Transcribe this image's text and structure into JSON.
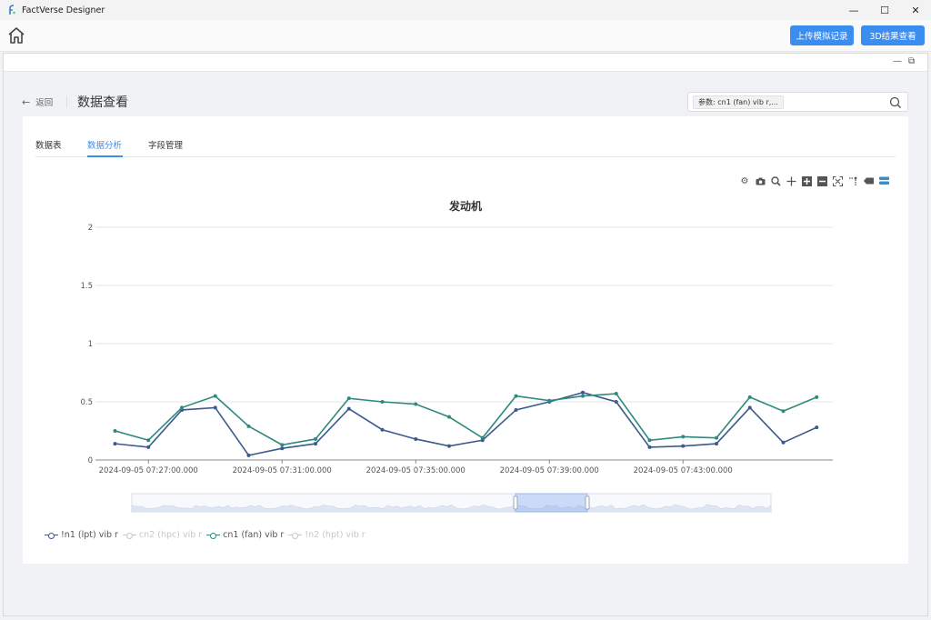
{
  "window": {
    "title": "FactVerse Designer",
    "minimize": "—",
    "maximize": "☐",
    "close": "✕"
  },
  "header": {
    "upload_label": "上传模拟记录",
    "result_label": "3D结果查看"
  },
  "inner_window": {
    "minimize": "—",
    "restore": "⧉"
  },
  "page": {
    "back_label": "返回",
    "title": "数据查看",
    "search_tag": "参数: cn1 (fan) vib r,..."
  },
  "tabs": [
    {
      "label": "数据表",
      "active": false
    },
    {
      "label": "数据分析",
      "active": true
    },
    {
      "label": "字段管理",
      "active": false
    }
  ],
  "toolbox": [
    "settings-icon",
    "camera-icon",
    "zoom-icon",
    "pan-icon",
    "zoom-in-icon",
    "zoom-out-icon",
    "autoscale-icon",
    "reset-axes-icon",
    "hover-closest-icon",
    "hover-compare-icon"
  ],
  "chart_data": {
    "type": "line",
    "title": "发动机",
    "xlabel": "",
    "ylabel": "",
    "ylim": [
      0,
      2
    ],
    "yticks": [
      "0",
      "0.5",
      "1",
      "1.5",
      "2"
    ],
    "xticks": [
      "2024-09-05 07:27:00.000",
      "2024-09-05 07:31:00.000",
      "2024-09-05 07:35:00.000",
      "2024-09-05 07:39:00.000",
      "2024-09-05 07:43:00.000"
    ],
    "x": [
      "07:26:00",
      "07:27:00",
      "07:28:00",
      "07:29:00",
      "07:30:00",
      "07:31:00",
      "07:32:00",
      "07:33:00",
      "07:34:00",
      "07:35:00",
      "07:36:00",
      "07:37:00",
      "07:38:00",
      "07:39:00",
      "07:40:00",
      "07:41:00",
      "07:42:00",
      "07:43:00",
      "07:44:00",
      "07:45:00",
      "07:46:00",
      "07:47:00",
      "07:48:00"
    ],
    "grid": true,
    "legend_position": "bottom-left",
    "series": [
      {
        "name": "!n1 (lpt) vib r",
        "color": "#3c5a8c",
        "visible": true,
        "values": [
          0.14,
          0.11,
          0.43,
          0.45,
          0.04,
          0.1,
          0.14,
          0.44,
          0.26,
          0.18,
          0.12,
          0.17,
          0.43,
          0.5,
          0.58,
          0.5,
          0.11,
          0.12,
          0.14,
          0.45,
          0.15,
          0.28
        ]
      },
      {
        "name": "cn2 (hpc) vib r",
        "color": "#c8c8c8",
        "visible": false,
        "values": []
      },
      {
        "name": "cn1 (fan) vib r",
        "color": "#2e8a7e",
        "visible": true,
        "values": [
          0.25,
          0.17,
          0.45,
          0.55,
          0.29,
          0.13,
          0.18,
          0.53,
          0.5,
          0.48,
          0.37,
          0.19,
          0.55,
          0.51,
          0.55,
          0.57,
          0.17,
          0.2,
          0.19,
          0.54,
          0.42,
          0.54
        ]
      },
      {
        "name": "!n2 (hpt) vib r",
        "color": "#c8c8c8",
        "visible": false,
        "values": []
      }
    ]
  }
}
